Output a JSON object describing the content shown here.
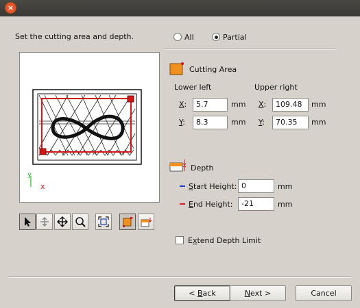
{
  "window": {
    "close_glyph": "×"
  },
  "instructions": "Set the cutting area and depth.",
  "scope": {
    "options": [
      {
        "label": "All",
        "selected": false
      },
      {
        "label": "Partial",
        "selected": true
      }
    ]
  },
  "cutting_area": {
    "title": "Cutting Area",
    "lower_left": {
      "heading": "Lower left",
      "x": "5.7",
      "y": "8.3",
      "unit": "mm"
    },
    "upper_right": {
      "heading": "Upper right",
      "x": "109.48",
      "y": "70.35",
      "unit": "mm"
    },
    "x_label": "X:",
    "y_label": "Y:"
  },
  "depth": {
    "title": "Depth",
    "start_height": {
      "label": "Start Height:",
      "value": "0",
      "unit": "mm",
      "marker_color": "#1f3bd6"
    },
    "end_height": {
      "label": "End Height:",
      "value": "-21",
      "unit": "mm",
      "marker_color": "#d42020"
    }
  },
  "extend_depth_limit": {
    "label": "Extend Depth Limit",
    "checked": false
  },
  "preview_axes": {
    "y": "y",
    "x": "x"
  },
  "toolbar": {
    "tools": [
      {
        "name": "select-tool",
        "icon": "pointer-arrow-icon",
        "pressed": true
      },
      {
        "name": "pan-tool",
        "icon": "hand-icon",
        "pressed": false
      },
      {
        "name": "move-tool",
        "icon": "move-arrows-icon",
        "pressed": false
      },
      {
        "name": "zoom-tool",
        "icon": "magnifier-icon",
        "pressed": false
      },
      {
        "name": "fit-tool",
        "icon": "fit-view-icon",
        "pressed": false
      },
      {
        "name": "cutting-area-tool",
        "icon": "cutting-area-icon",
        "pressed": true
      },
      {
        "name": "depth-tool",
        "icon": "depth-icon",
        "pressed": false
      }
    ]
  },
  "buttons": {
    "back": "< Back",
    "next": "Next >",
    "cancel": "Cancel"
  },
  "colors": {
    "accent_orange": "#f0901e",
    "selection_red": "#d01818",
    "axis_green": "#2ab52a"
  }
}
